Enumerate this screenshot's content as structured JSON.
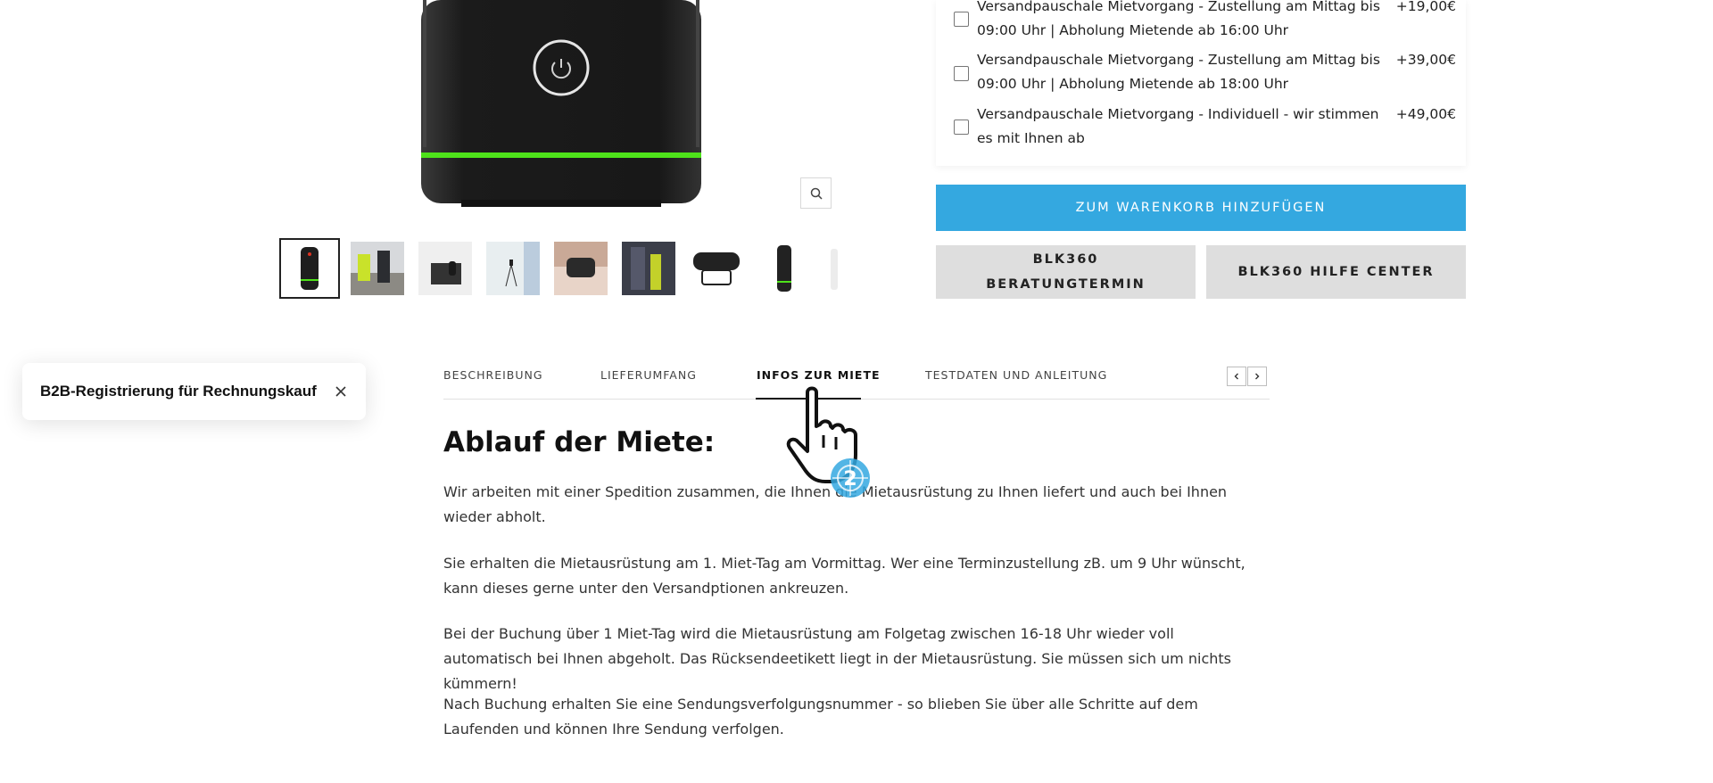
{
  "shipping": {
    "options": [
      {
        "label": "Versandpauschale Mietvorgang - Zustellung am Mittag bis 09:00 Uhr | Abholung Mietende ab 16:00 Uhr",
        "price": "+19,00€"
      },
      {
        "label": "Versandpauschale Mietvorgang - Zustellung am Mittag bis 09:00 Uhr | Abholung Mietende ab 18:00 Uhr",
        "price": "+39,00€"
      },
      {
        "label": "Versandpauschale Mietvorgang - Individuell - wir stimmen es mit Ihnen ab",
        "price": "+49,00€"
      }
    ]
  },
  "buttons": {
    "add_to_cart": "ZUM WARENKORB HINZUFÜGEN",
    "consult": "BLK360 BERATUNGTERMIN",
    "help_center": "BLK360 HILFE CENTER"
  },
  "b2b_popup": {
    "text": "B2B-Registrierung für Rechnungskauf"
  },
  "tabs": [
    {
      "label": "BESCHREIBUNG"
    },
    {
      "label": "LIEFERUMFANG"
    },
    {
      "label": "INFOS ZUR MIETE"
    },
    {
      "label": "TESTDATEN UND ANLEITUNG"
    }
  ],
  "active_tab": "INFOS ZUR MIETE",
  "content": {
    "heading": "Ablauf der Miete:",
    "paragraphs": [
      "Wir arbeiten mit einer Spedition zusammen, die Ihnen die Mietausrüstung zu Ihnen liefert und auch bei Ihnen wieder abholt.",
      "Sie erhalten die Mietausrüstung am 1. Miet-Tag am Vormittag. Wer eine Terminzustellung zB. um 9 Uhr wünscht, kann dieses gerne unter den Versandptionen ankreuzen.",
      "Bei der Buchung über 1 Miet-Tag wird die Mietausrüstung am Folgetag zwischen 16-18 Uhr wieder voll automatisch bei Ihnen abgeholt. Das Rücksendeetikett liegt in der Mietausrüstung. Sie müssen sich um nichts kümmern!",
      "Nach Buchung erhalten Sie eine Sendungsverfolgungsnummer - so blieben Sie über alle Schritte auf dem Laufenden und können Ihre Sendung verfolgen."
    ]
  },
  "colors": {
    "accent": "#34a8e0",
    "secondary_button": "#dedede",
    "device_glow": "#4ee21a",
    "device_body": "#1c1c1c"
  },
  "cursor_step": "2"
}
